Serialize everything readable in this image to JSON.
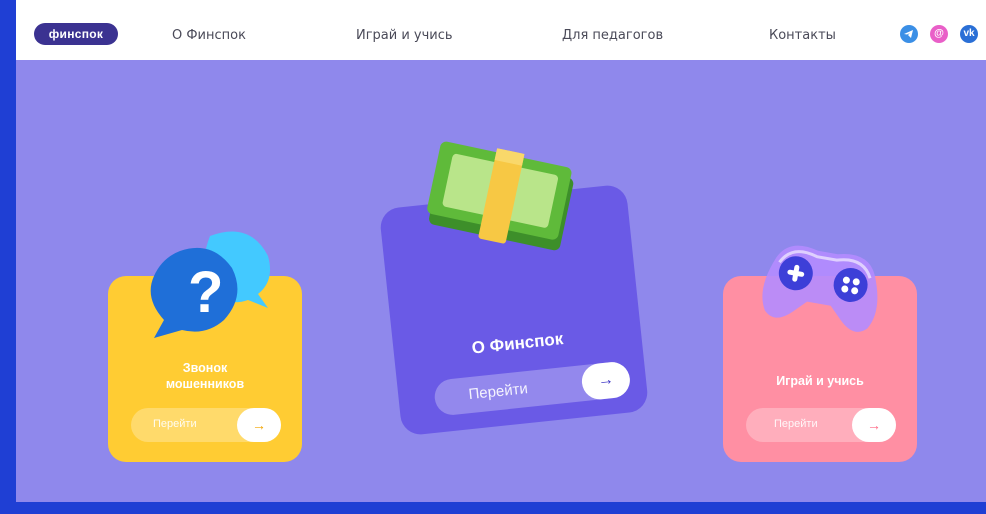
{
  "header": {
    "logo": "финспок",
    "nav": [
      "О Финспок",
      "Играй и учись",
      "Для педагогов",
      "Контакты"
    ],
    "social_icons": [
      "telegram-icon",
      "mail-icon",
      "vk-icon"
    ]
  },
  "cards": {
    "left": {
      "title": "Звонок\nмошенников",
      "button": "Перейти",
      "icon": "question-bubbles-icon",
      "color": "#ffcc33"
    },
    "center": {
      "title": "О Финспок",
      "button": "Перейти",
      "icon": "money-stack-icon",
      "color": "#6a5ae6"
    },
    "right": {
      "title": "Играй и учись",
      "button": "Перейти",
      "icon": "gamepad-icon",
      "color": "#ff8fa3"
    }
  },
  "colors": {
    "background": "#8f88ec",
    "frame": "#1f3fd4",
    "accent": "#2ec5e8"
  }
}
